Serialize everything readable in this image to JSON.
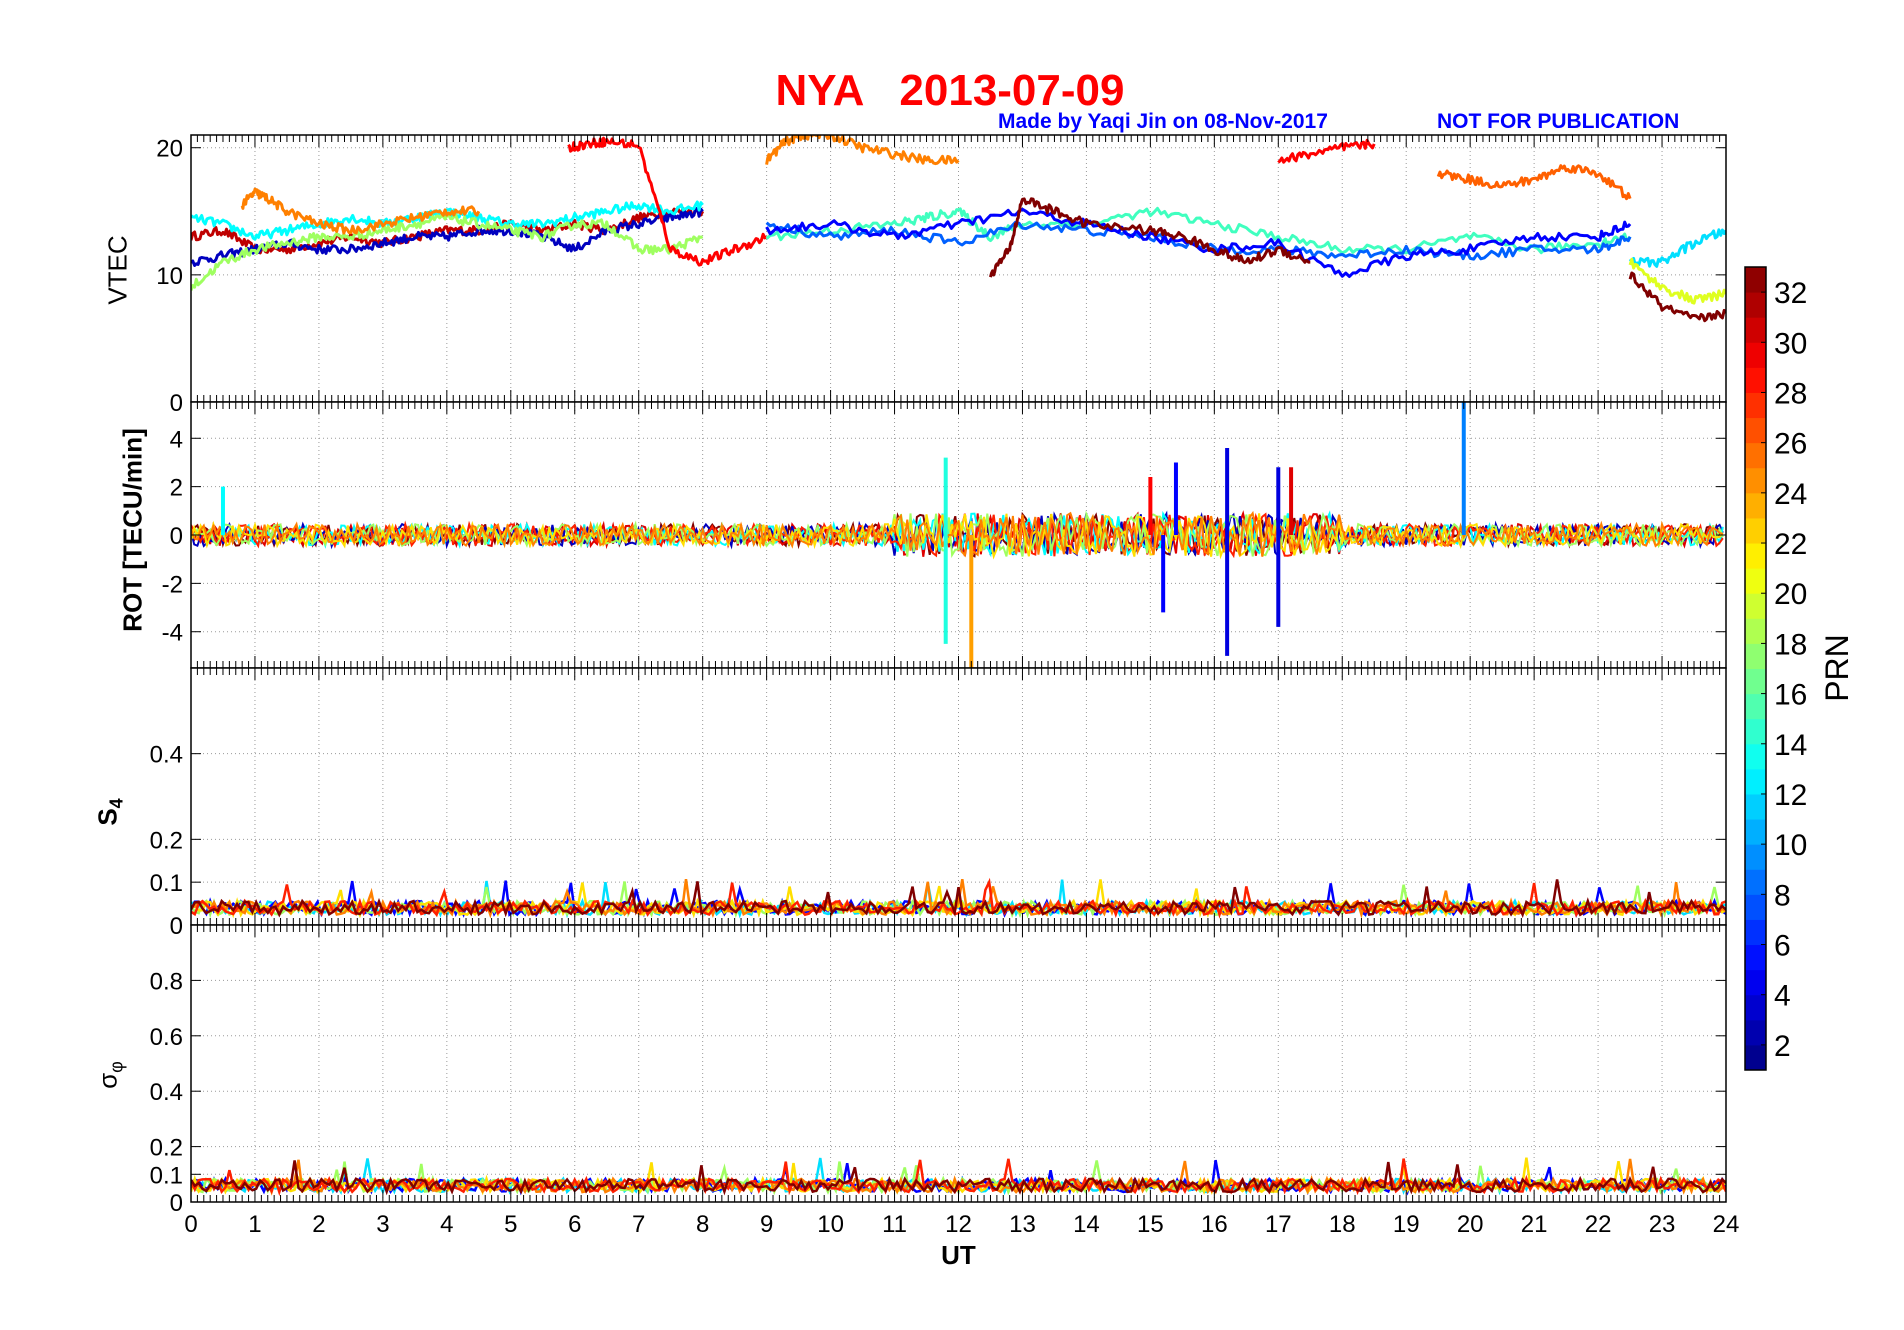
{
  "title": "NYA   2013-07-09",
  "credit": "Made by Yaqi Jin on 08-Nov-2017",
  "notice": "NOT FOR PUBLICATION",
  "colorbar": {
    "label": "PRN",
    "ticks": [
      2,
      4,
      6,
      8,
      10,
      12,
      14,
      16,
      18,
      20,
      22,
      24,
      26,
      28,
      30,
      32
    ],
    "range": [
      1,
      33
    ],
    "colormap": "jet"
  },
  "xaxis": {
    "label": "UT",
    "range": [
      0,
      24
    ],
    "ticks": [
      0,
      1,
      2,
      3,
      4,
      5,
      6,
      7,
      8,
      9,
      10,
      11,
      12,
      13,
      14,
      15,
      16,
      17,
      18,
      19,
      20,
      21,
      22,
      23,
      24
    ]
  },
  "chart_data": [
    {
      "type": "line",
      "panel": "vtec",
      "ylabel": "VTEC",
      "ylim": [
        0,
        21
      ],
      "yticks": [
        0,
        10,
        20
      ],
      "grid": true,
      "series": [
        {
          "prn": 31,
          "x": [
            0,
            0.5,
            1,
            1.5,
            2,
            2.5,
            3,
            3.5,
            4,
            4.5,
            5,
            5.5,
            6,
            6.5,
            7,
            7.5,
            8
          ],
          "y": [
            13,
            13.5,
            12,
            12,
            12.5,
            13,
            12.5,
            13,
            13.5,
            13.5,
            14,
            13.5,
            14,
            13.5,
            14.5,
            15,
            15
          ]
        },
        {
          "prn": 3,
          "x": [
            0,
            0.5,
            1,
            1.5,
            2,
            2.5,
            3,
            3.5,
            4,
            4.5,
            5,
            5.5,
            6,
            6.5,
            7,
            7.5,
            8
          ],
          "y": [
            11,
            11.5,
            12,
            12.5,
            12,
            12,
            12.5,
            13,
            13,
            13.5,
            13.5,
            13,
            12,
            13.5,
            14,
            14.5,
            15
          ]
        },
        {
          "prn": 13,
          "x": [
            0,
            0.5,
            1,
            1.5,
            2,
            2.5,
            3,
            3.5,
            4,
            4.5,
            5,
            5.5,
            6,
            6.5,
            7,
            7.5,
            8
          ],
          "y": [
            14.5,
            14,
            13,
            13.5,
            14,
            14.5,
            14,
            14.5,
            15,
            14.5,
            14,
            14,
            14.5,
            15,
            15.5,
            15,
            15.5
          ]
        },
        {
          "prn": 18,
          "x": [
            0,
            0.5,
            1,
            1.5,
            2,
            2.5,
            3,
            3.5,
            4,
            4.5,
            5,
            5.5,
            6,
            6.5,
            7,
            7.5,
            8
          ],
          "y": [
            9,
            11,
            12,
            12.5,
            13,
            13,
            13.5,
            14,
            14.5,
            14,
            13.5,
            13,
            14,
            14,
            12,
            12,
            13
          ]
        },
        {
          "prn": 25,
          "x": [
            0.8,
            1,
            1.2,
            1.5,
            2,
            2.5,
            3,
            3.5,
            4,
            4.5
          ],
          "y": [
            15.5,
            16.5,
            16,
            15,
            14,
            13.5,
            14,
            14.5,
            15,
            15
          ]
        },
        {
          "prn": 29,
          "x": [
            5.9,
            6.2,
            6.5,
            7,
            7.5,
            8,
            8.5,
            9
          ],
          "y": [
            20,
            20.3,
            20.5,
            20.2,
            12,
            11,
            12,
            13
          ]
        },
        {
          "prn": 25,
          "x": [
            9,
            9.3,
            9.6,
            10,
            10.5,
            11,
            11.5,
            12
          ],
          "y": [
            19,
            20.5,
            21,
            21,
            20,
            19.5,
            19,
            19
          ]
        },
        {
          "prn": 15,
          "x": [
            9,
            10,
            11,
            11.5,
            12,
            12.5,
            13,
            14,
            15,
            16,
            17,
            18,
            19,
            20,
            21,
            22,
            22.5
          ],
          "y": [
            13,
            13.5,
            14,
            14.5,
            15,
            13,
            14,
            14,
            15,
            14,
            13,
            12,
            12,
            13,
            12,
            12.5,
            13
          ]
        },
        {
          "prn": 8,
          "x": [
            9,
            10,
            11,
            12,
            13,
            14,
            15,
            16,
            17,
            18,
            19,
            20,
            21,
            22,
            22.5
          ],
          "y": [
            14,
            13,
            13.5,
            12.5,
            14,
            13.5,
            13,
            12,
            12,
            11.5,
            12,
            11.5,
            12,
            12,
            13
          ]
        },
        {
          "prn": 5,
          "x": [
            9,
            10,
            11,
            12,
            13,
            14,
            15,
            16,
            17,
            18,
            19,
            20,
            21,
            22,
            22.5
          ],
          "y": [
            13.5,
            14,
            13,
            14,
            15,
            14,
            13,
            12,
            12.5,
            10,
            11.5,
            12,
            13,
            13,
            14
          ]
        },
        {
          "prn": 33,
          "x": [
            12.5,
            12.8,
            13,
            13.5,
            14,
            15,
            15.5,
            16,
            16.5,
            17,
            17.5
          ],
          "y": [
            10,
            12,
            16,
            15,
            14,
            13.5,
            13,
            12,
            11,
            12,
            11
          ]
        },
        {
          "prn": 29,
          "x": [
            17,
            17.5,
            18,
            18.5
          ],
          "y": [
            19,
            19.5,
            20,
            20.3
          ]
        },
        {
          "prn": 26,
          "x": [
            19.5,
            20,
            20.5,
            21,
            21.5,
            22,
            22.5
          ],
          "y": [
            18,
            17.5,
            17,
            17.5,
            18.5,
            18,
            16
          ]
        },
        {
          "prn": 12,
          "x": [
            22.5,
            23,
            23.5,
            24
          ],
          "y": [
            11,
            11,
            12.5,
            13.5
          ]
        },
        {
          "prn": 20,
          "x": [
            22.5,
            23,
            23.5,
            24
          ],
          "y": [
            11,
            9,
            8,
            8.5
          ]
        },
        {
          "prn": 33,
          "x": [
            22.5,
            23,
            23.5,
            24
          ],
          "y": [
            10,
            7.5,
            6.5,
            7
          ]
        }
      ]
    },
    {
      "type": "line",
      "panel": "rot",
      "ylabel": "ROT [TECU/min]",
      "ylim": [
        -5.5,
        5.5
      ],
      "yticks": [
        -4,
        -2,
        0,
        2,
        4
      ],
      "grid": true,
      "spikes": [
        {
          "prn": 13,
          "x": 0.5,
          "y": 2
        },
        {
          "prn": 14,
          "x": 11.8,
          "y": 3.2
        },
        {
          "prn": 14,
          "x": 11.8,
          "y": -4.5
        },
        {
          "prn": 24,
          "x": 12.2,
          "y": -5.5
        },
        {
          "prn": 5,
          "x": 15.4,
          "y": 3
        },
        {
          "prn": 5,
          "x": 15.2,
          "y": -3.2
        },
        {
          "prn": 4,
          "x": 16.2,
          "y": 3.6
        },
        {
          "prn": 4,
          "x": 16.2,
          "y": -5
        },
        {
          "prn": 4,
          "x": 17,
          "y": 2.8
        },
        {
          "prn": 4,
          "x": 17,
          "y": -3.8
        },
        {
          "prn": 9,
          "x": 19.9,
          "y": 5.5
        },
        {
          "prn": 29,
          "x": 15,
          "y": 2.4
        },
        {
          "prn": 30,
          "x": 17.2,
          "y": 2.8
        }
      ]
    },
    {
      "type": "line",
      "panel": "s4",
      "ylabel": "S4",
      "ylim": [
        0,
        0.6
      ],
      "yticks": [
        0,
        0.1,
        0.2,
        0.4
      ],
      "grid": true,
      "baseline": 0.04
    },
    {
      "type": "line",
      "panel": "sigma_phi",
      "ylabel": "σφ",
      "ylim": [
        0,
        1
      ],
      "yticks": [
        0,
        0.1,
        0.2,
        0.4,
        0.6,
        0.8
      ],
      "grid": true,
      "baseline": 0.06
    }
  ],
  "axis_labels": {
    "vtec": "VTEC",
    "rot": "ROT [TECU/min]",
    "s4_main": "S",
    "s4_sub": "4",
    "sig_main": "σ",
    "sig_sub": "φ"
  }
}
